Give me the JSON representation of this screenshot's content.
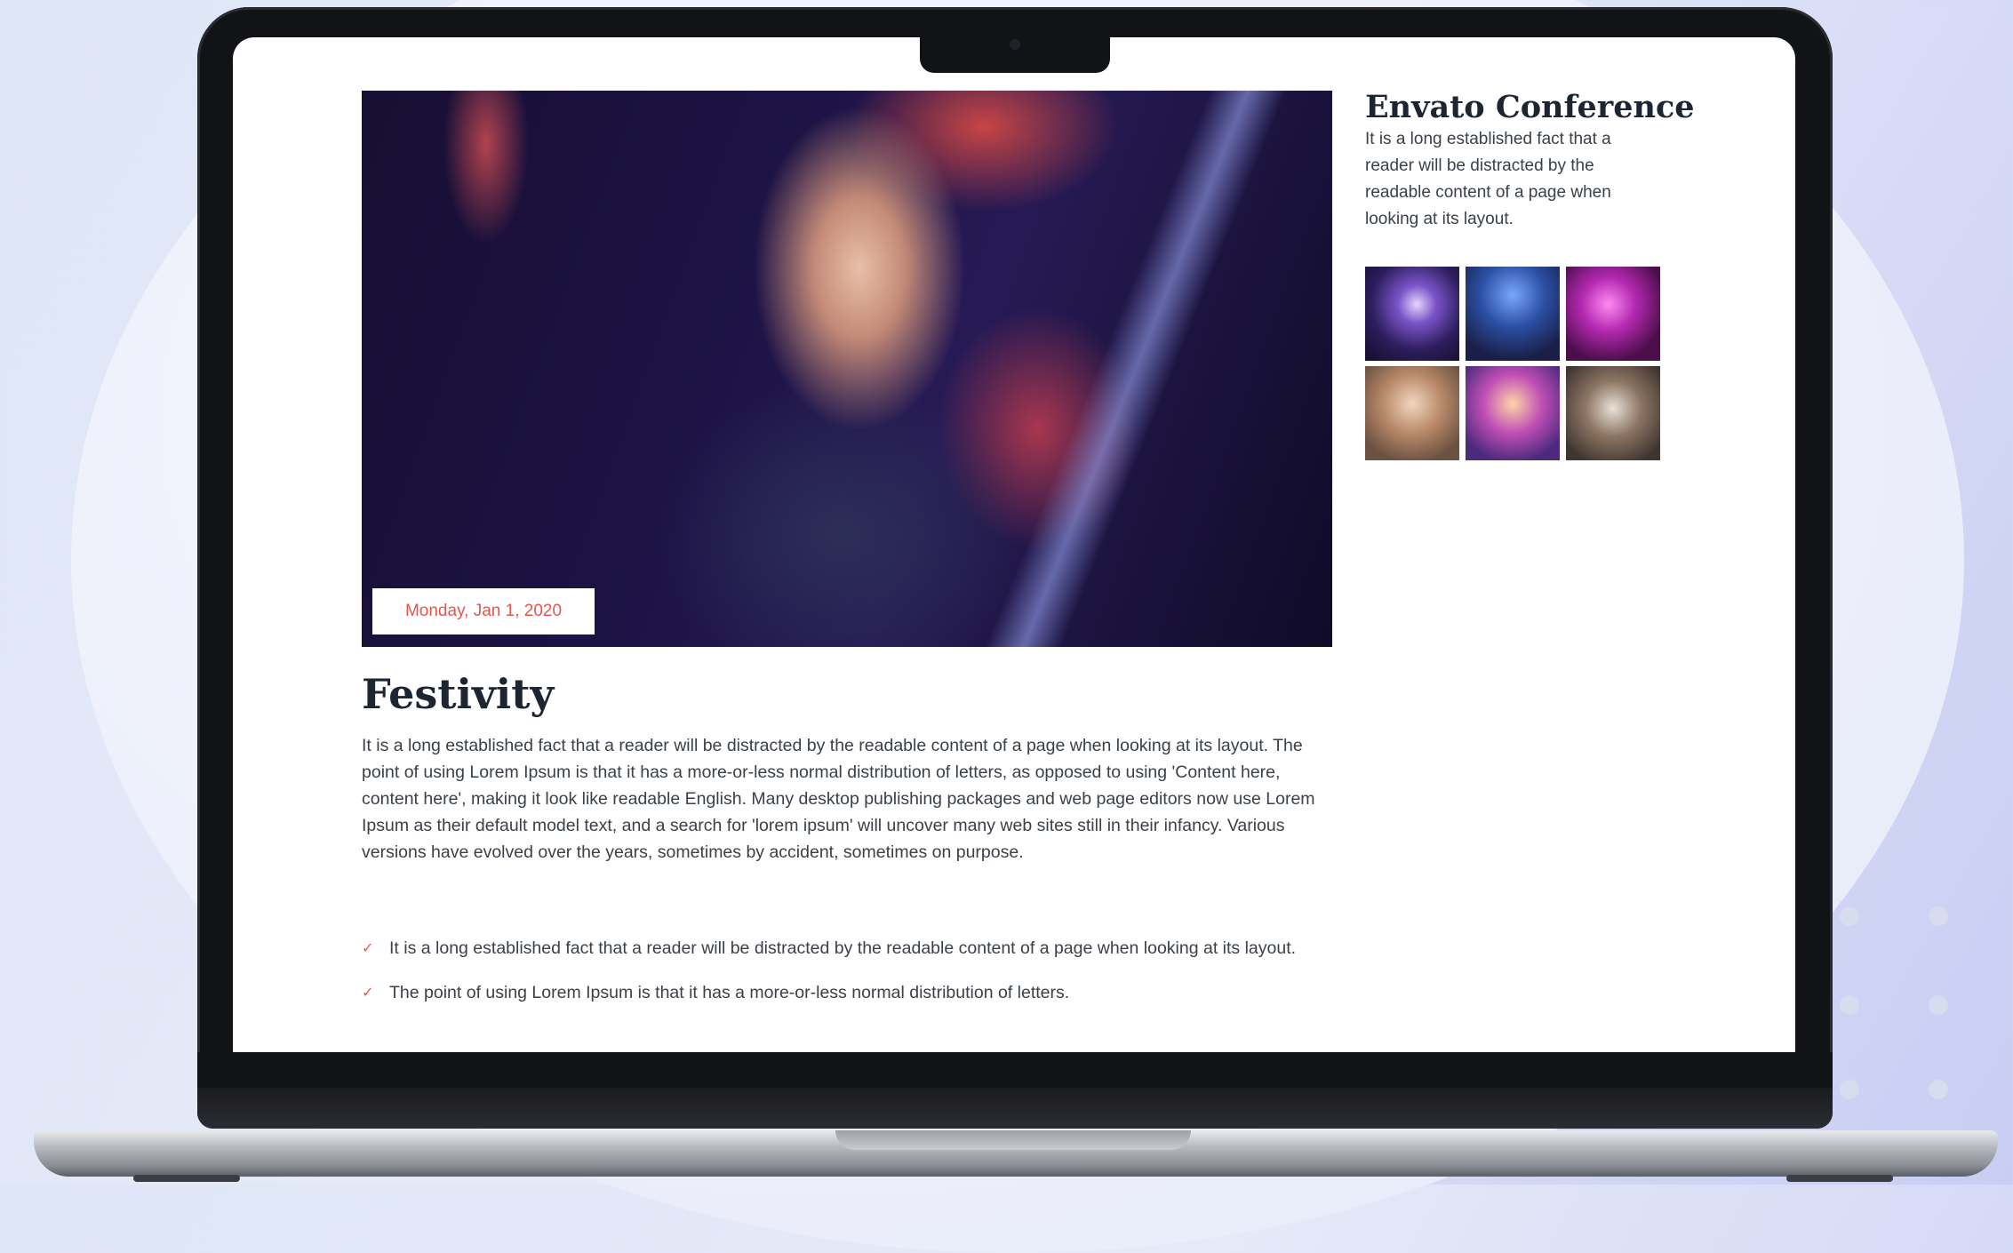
{
  "article": {
    "date": "Monday, Jan 1, 2020",
    "title": "Festivity",
    "body": "It is a long established fact that a reader will be distracted by the readable content of a page when looking at its layout. The point of using Lorem Ipsum is that it has a more-or-less normal distribution of letters, as opposed to using 'Content here, content here', making it look like readable English. Many desktop publishing packages and web page editors now use Lorem Ipsum as their default model text, and a search for 'lorem ipsum' will uncover many web sites still in their infancy. Various versions have evolved over the years, sometimes by accident, sometimes on purpose.",
    "checklist": [
      "It is a long established fact that a reader will be distracted by the readable content of a page when looking at its layout.",
      "The point of using Lorem Ipsum is that it has a more-or-less normal distribution of letters."
    ]
  },
  "sidebar": {
    "title": "Envato Conference",
    "text": "It is a long established fact that a reader will be distracted by the readable content of a page when looking at its layout.",
    "gallery_count": 6
  },
  "colors": {
    "accent": "#e2564f",
    "heading": "#1c2531",
    "text": "#3b4148"
  }
}
